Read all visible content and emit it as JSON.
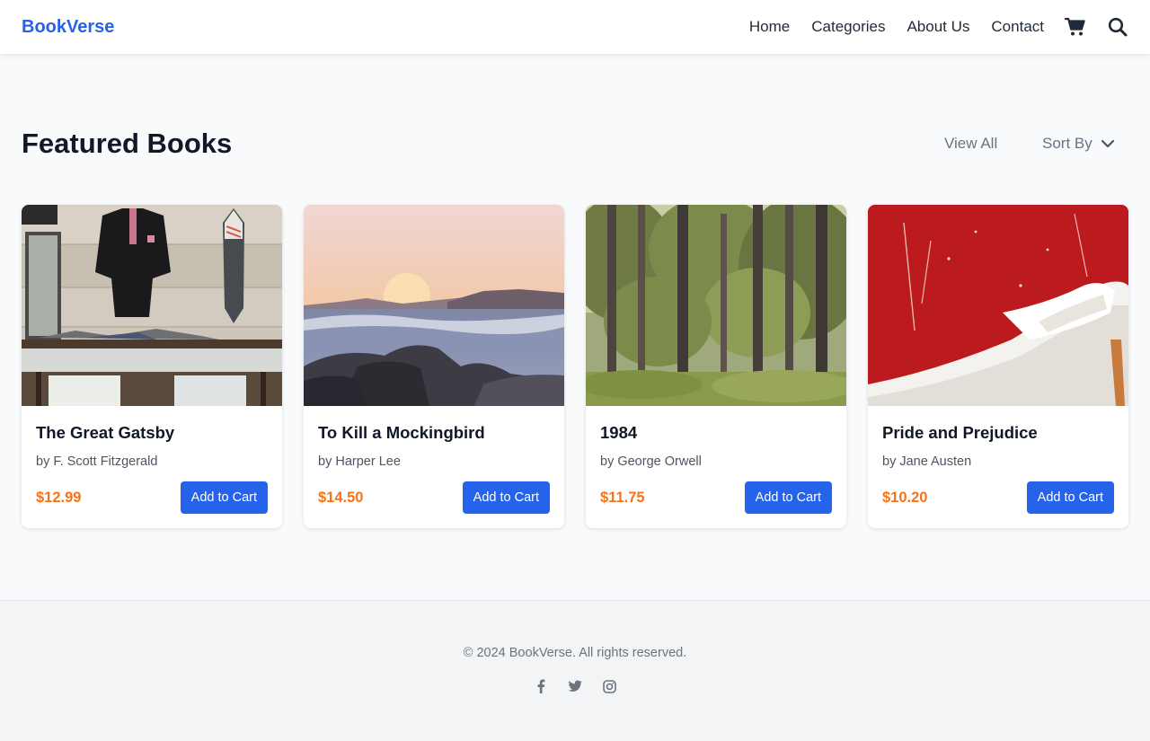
{
  "header": {
    "brand": "BookVerse",
    "nav": [
      "Home",
      "Categories",
      "About Us",
      "Contact"
    ],
    "icons": [
      "cart-icon",
      "search-icon"
    ]
  },
  "section": {
    "title": "Featured Books",
    "view_all": "View All",
    "sort_by": "Sort By"
  },
  "books": [
    {
      "title": "The Great Gatsby",
      "author": "by F. Scott Fitzgerald",
      "price": "$12.99",
      "button": "Add to Cart",
      "image": "clothing-rack-photo"
    },
    {
      "title": "To Kill a Mockingbird",
      "author": "by Harper Lee",
      "price": "$14.50",
      "button": "Add to Cart",
      "image": "ocean-sunset-photo"
    },
    {
      "title": "1984",
      "author": "by George Orwell",
      "price": "$11.75",
      "button": "Add to Cart",
      "image": "forest-photo"
    },
    {
      "title": "Pride and Prejudice",
      "author": "by Jane Austen",
      "price": "$10.20",
      "button": "Add to Cart",
      "image": "white-heels-photo"
    }
  ],
  "footer": {
    "copyright": "© 2024 BookVerse. All rights reserved.",
    "socials": [
      "facebook-icon",
      "twitter-icon",
      "instagram-icon"
    ]
  },
  "colors": {
    "brand": "#2563eb",
    "price": "#f97316",
    "button": "#2563eb",
    "background": "#f8fafc",
    "footer_bg": "#f3f4f6"
  }
}
